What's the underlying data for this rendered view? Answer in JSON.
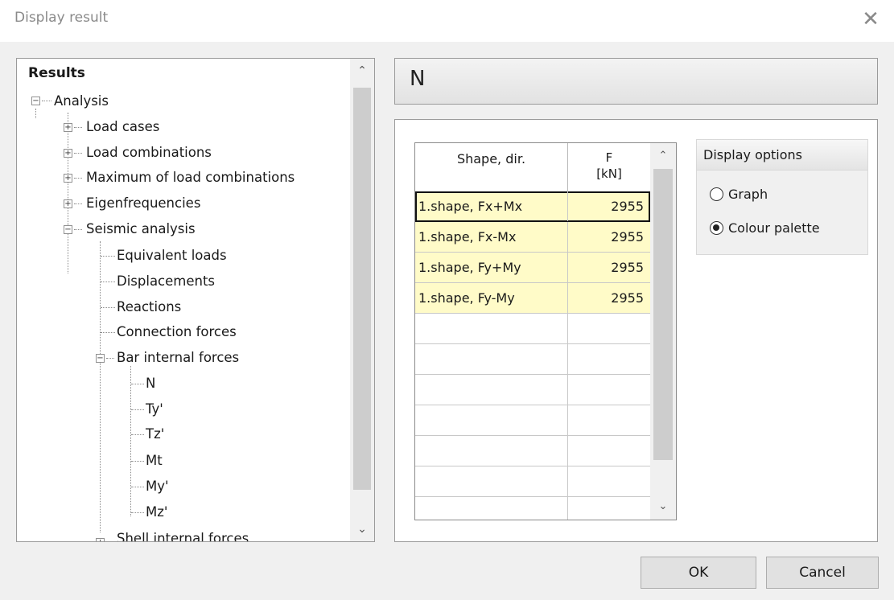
{
  "window": {
    "title": "Display result",
    "close_icon": "close-icon"
  },
  "tree": {
    "root": "Results",
    "analysis": "Analysis",
    "load_cases": "Load cases",
    "load_combinations": "Load combinations",
    "max_load_combinations": "Maximum of load combinations",
    "eigenfrequencies": "Eigenfrequencies",
    "seismic_analysis": "Seismic analysis",
    "equivalent_loads": "Equivalent loads",
    "displacements": "Displacements",
    "reactions": "Reactions",
    "connection_forces": "Connection forces",
    "bar_internal_forces": "Bar internal forces",
    "n": "N",
    "ty": "Ty'",
    "tz": "Tz'",
    "mt": "Mt",
    "my": "My'",
    "mz": "Mz'",
    "shell_internal_forces": "Shell internal forces"
  },
  "header": {
    "title": "N"
  },
  "grid": {
    "col_shape": "Shape, dir.",
    "col_f": "F",
    "col_f_unit": "[kN]",
    "rows": [
      {
        "shape": "1.shape, Fx+Mx",
        "value": "2955"
      },
      {
        "shape": "1.shape, Fx-Mx",
        "value": "2955"
      },
      {
        "shape": "1.shape, Fy+My",
        "value": "2955"
      },
      {
        "shape": "1.shape, Fy-My",
        "value": "2955"
      }
    ]
  },
  "display_options": {
    "title": "Display options",
    "graph": "Graph",
    "colour_palette": "Colour palette",
    "selected": "colour_palette"
  },
  "buttons": {
    "ok": "OK",
    "cancel": "Cancel"
  }
}
